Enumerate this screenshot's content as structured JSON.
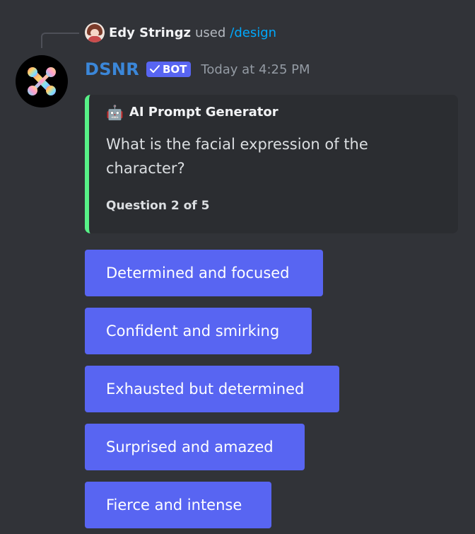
{
  "reply": {
    "username": "Edy Stringz",
    "used_text": "used",
    "command": "/design"
  },
  "message": {
    "bot_name": "DSNR",
    "badge_label": "BOT",
    "timestamp": "Today at 4:25 PM"
  },
  "embed": {
    "author_icon": "robot-icon",
    "author": "AI Prompt Generator",
    "description": "What is the facial expression of the character?",
    "footer": "Question 2 of 5",
    "accent_color": "#57f287"
  },
  "buttons": [
    "Determined and focused",
    "Confident and smirking",
    "Exhausted but determined",
    "Surprised and amazed",
    "Fierce and intense"
  ],
  "colors": {
    "background": "#313338",
    "button": "#5865f2",
    "bot_name": "#3b87d9",
    "command": "#00a8fc"
  }
}
